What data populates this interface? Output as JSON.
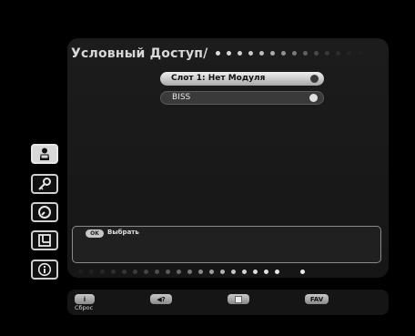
{
  "header": {
    "title": "Условный Доступ/"
  },
  "slots": [
    {
      "label": "Слот 1: Нет Модуля",
      "selected": true
    },
    {
      "label": "BISS",
      "selected": false
    }
  ],
  "sidebar": {
    "items": [
      {
        "icon": "access-card-icon",
        "active": true
      },
      {
        "icon": "key-icon",
        "active": false
      },
      {
        "icon": "clock-icon",
        "active": false
      },
      {
        "icon": "storage-icon",
        "active": false
      },
      {
        "icon": "info-icon",
        "active": false
      }
    ]
  },
  "info_box": {
    "ok_label": "OK",
    "select_label": "Выбрать"
  },
  "footer": {
    "info_glyph": "i",
    "reset_label": "Сброс",
    "audio_label": "◀?",
    "fav_label": "FAV"
  },
  "colors": {
    "background": "#000000",
    "panel": "#1a1a1a",
    "highlight": "#d8d8d8"
  }
}
